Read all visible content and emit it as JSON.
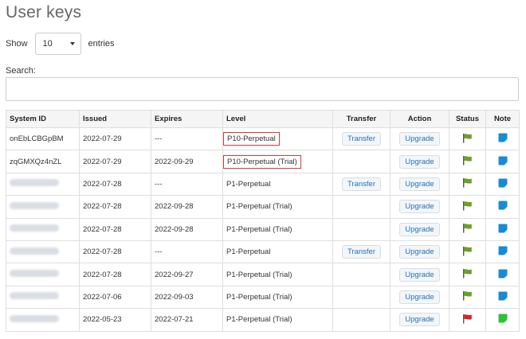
{
  "page": {
    "title": "User keys"
  },
  "length_control": {
    "show_label": "Show",
    "value": "10",
    "entries_label": "entries"
  },
  "search": {
    "label": "Search:",
    "value": ""
  },
  "table": {
    "headers": [
      "System ID",
      "Issued",
      "Expires",
      "Level",
      "Transfer",
      "Action",
      "Status",
      "Note"
    ],
    "transfer_label": "Transfer",
    "upgrade_label": "Upgrade",
    "rows": [
      {
        "system_id": "onEbLCBGpBM",
        "issued": "2022-07-29",
        "expires": "---",
        "level": "P10-Perpetual",
        "transfer": true,
        "status": "green",
        "note": "blue",
        "highlight": true
      },
      {
        "system_id": "zqGMXQz4nZL",
        "issued": "2022-07-29",
        "expires": "2022-09-29",
        "level": "P10-Perpetual (Trial)",
        "transfer": false,
        "status": "green",
        "note": "blue",
        "highlight": true
      },
      {
        "system_id": "",
        "issued": "2022-07-28",
        "expires": "---",
        "level": "P1-Perpetual",
        "transfer": true,
        "status": "green",
        "note": "blue",
        "highlight": false
      },
      {
        "system_id": "",
        "issued": "2022-07-28",
        "expires": "2022-09-28",
        "level": "P1-Perpetual (Trial)",
        "transfer": false,
        "status": "green",
        "note": "blue",
        "highlight": false
      },
      {
        "system_id": "",
        "issued": "2022-07-28",
        "expires": "2022-09-28",
        "level": "P1-Perpetual (Trial)",
        "transfer": false,
        "status": "green",
        "note": "blue",
        "highlight": false
      },
      {
        "system_id": "",
        "issued": "2022-07-28",
        "expires": "---",
        "level": "P1-Perpetual",
        "transfer": true,
        "status": "green",
        "note": "blue",
        "highlight": false
      },
      {
        "system_id": "",
        "issued": "2022-07-28",
        "expires": "2022-09-27",
        "level": "P1-Perpetual (Trial)",
        "transfer": false,
        "status": "green",
        "note": "blue",
        "highlight": false
      },
      {
        "system_id": "",
        "issued": "2022-07-06",
        "expires": "2022-09-03",
        "level": "P1-Perpetual (Trial)",
        "transfer": false,
        "status": "green",
        "note": "blue",
        "highlight": false
      },
      {
        "system_id": "",
        "issued": "2022-05-23",
        "expires": "2022-07-21",
        "level": "P1-Perpetual (Trial)",
        "transfer": false,
        "status": "red",
        "note": "green",
        "highlight": false
      }
    ]
  },
  "icons": {
    "status": "flag-icon",
    "note": "note-icon"
  },
  "colors": {
    "flag_green": "#6aa321",
    "flag_red": "#e02020",
    "note_blue": "#1a8ad4",
    "note_green": "#2fbf3a",
    "highlight": "#d83a3a",
    "button_text": "#2a6fb4"
  }
}
